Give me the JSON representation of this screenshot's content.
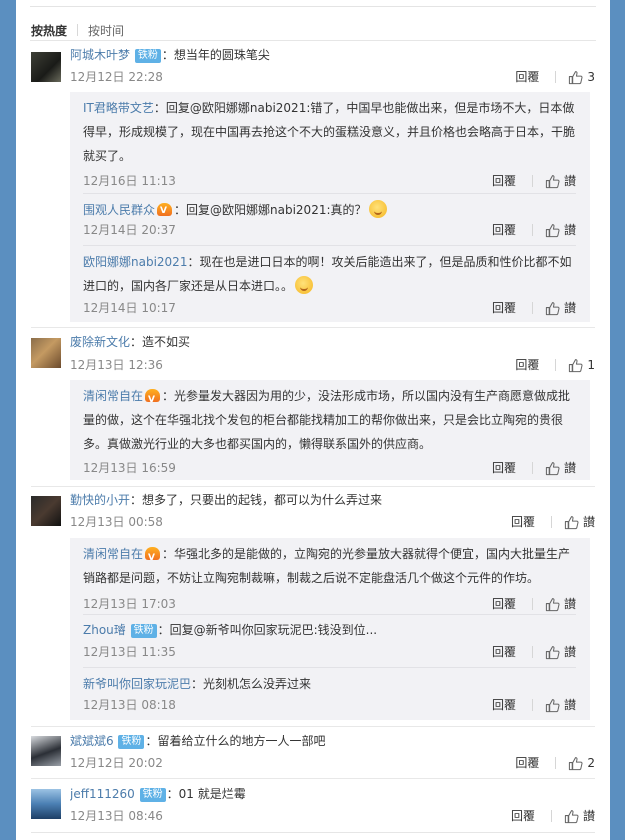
{
  "sort": {
    "hot": "按热度",
    "time": "按时间"
  },
  "reply_label": "回覆",
  "like_text": "讃",
  "comments": [
    {
      "user": "阿城木叶梦",
      "badge": "铁粉",
      "text": "：想当年的圆珠笔尖",
      "time": "12月12日 22:28",
      "likes": "3",
      "replies": [
        {
          "user": "IT君略带文艺",
          "text": "：回复@欧阳娜娜nabi2021:错了，中国早也能做出来，但是市场不大，日本做得早，形成规模了，现在中国再去抢这个不大的蛋糕没意义，并且价格也会略高于日本，干脆就买了。",
          "time": "12月16日 11:13"
        },
        {
          "user": "围观人民群众",
          "text": "：回复@欧阳娜娜nabi2021:真的？",
          "time": "12月14日 20:37"
        },
        {
          "user": "欧阳娜娜nabi2021",
          "text": "：现在也是进口日本的啊！攻关后能造出来了，但是品质和性价比都不如进口的，国内各厂家还是从日本进口。。",
          "time": "12月14日 10:17"
        }
      ]
    },
    {
      "user": "废除新文化",
      "text": "：造不如买",
      "time": "12月13日 12:36",
      "likes": "1",
      "replies": [
        {
          "user": "清闲常自在",
          "text": "：光参量发大器因为用的少，没法形成市场，所以国内没有生产商愿意做成批量的做，这个在华强北找个发包的柜台都能找精加工的帮你做出来，只是会比立陶宛的贵很多。真做激光行业的大多也都买国内的，懒得联系国外的供应商。",
          "time": "12月13日 16:59"
        }
      ]
    },
    {
      "user": "勤快的小开",
      "text": "：想多了，只要出的起钱，都可以为什么弄过来",
      "time": "12月13日 00:58",
      "replies": [
        {
          "user": "清闲常自在",
          "text": "：华强北多的是能做的，立陶宛的光参量放大器就得个便宜，国内大批量生产销路都是问题，不妨让立陶宛制裁嘛，制裁之后说不定能盘活几个做这个元件的作坊。",
          "time": "12月13日 17:03"
        },
        {
          "user": "Zhou璿",
          "badge": "铁粉",
          "text": "：回复@新爷叫你回家玩泥巴:钱没到位...",
          "time": "12月13日 11:35"
        },
        {
          "user": "新爷叫你回家玩泥巴",
          "text": "：光刻机怎么没弄过来",
          "time": "12月13日 08:18"
        }
      ]
    },
    {
      "user": "斌斌斌6",
      "badge": "铁粉",
      "text": "：留着给立什么的地方一人一部吧",
      "time": "12月12日 20:02",
      "likes": "2"
    },
    {
      "user": "jeff111260",
      "badge": "铁粉",
      "text": "：01  就是烂霉",
      "time": "12月13日 08:46"
    }
  ]
}
